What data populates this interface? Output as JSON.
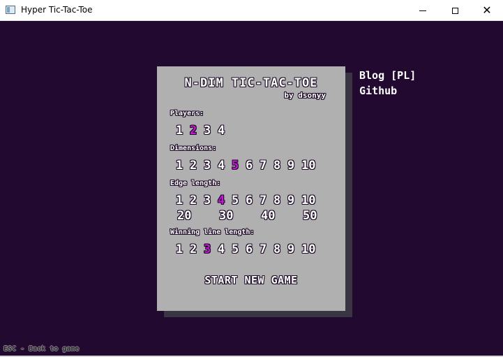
{
  "window": {
    "title": "Hyper Tic-Tac-Toe",
    "minimize": "",
    "maximize": "",
    "close": "✕"
  },
  "colors": {
    "background": "#220930",
    "panel": "#b0b0b0",
    "selected": "#c318d4",
    "text": "#ffffff"
  },
  "menu": {
    "title": "N-DIM TIC-TAC-TOE",
    "byline": "by dsonyy",
    "players": {
      "label": "Players:",
      "options": [
        "1",
        "2",
        "3",
        "4"
      ],
      "selected": "2"
    },
    "dimensions": {
      "label": "Dimensions:",
      "options": [
        "1",
        "2",
        "3",
        "4",
        "5",
        "6",
        "7",
        "8",
        "9",
        "10"
      ],
      "selected": "5"
    },
    "edge_length": {
      "label": "Edge length:",
      "options": [
        "1",
        "2",
        "3",
        "4",
        "5",
        "6",
        "7",
        "8",
        "9",
        "10"
      ],
      "options_extra": [
        "20",
        "30",
        "40",
        "50"
      ],
      "selected": "4"
    },
    "winning_line_length": {
      "label": "Winning line length:",
      "options": [
        "1",
        "2",
        "3",
        "4",
        "5",
        "6",
        "7",
        "8",
        "9",
        "10"
      ],
      "selected": "3"
    },
    "start_label": "START NEW GAME"
  },
  "links": {
    "blog": "Blog [PL]",
    "github": "Github"
  },
  "hint": "ESC - Back to game"
}
